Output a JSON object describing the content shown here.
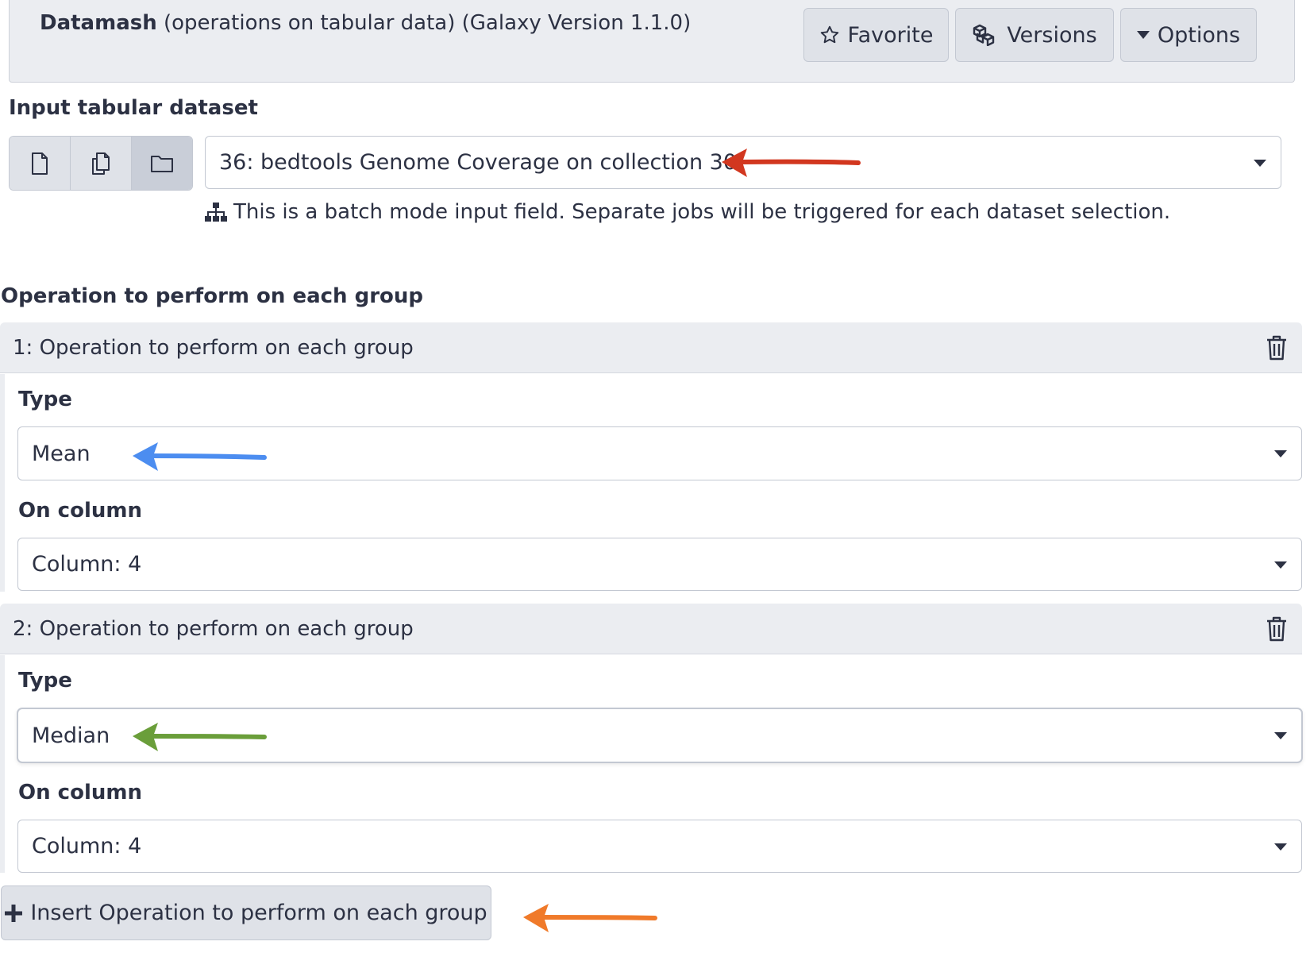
{
  "header": {
    "tool_name": "Datamash",
    "tool_description": "(operations on tabular data)",
    "tool_version": "(Galaxy Version 1.1.0)",
    "buttons": {
      "favorite": "Favorite",
      "versions": "Versions",
      "options": "Options"
    }
  },
  "input_dataset": {
    "label": "Input tabular dataset",
    "selected": "36: bedtools Genome Coverage on collection 30",
    "batch_note": "This is a batch mode input field. Separate jobs will be triggered for each dataset selection."
  },
  "operations": {
    "section_label": "Operation to perform on each group",
    "groups": [
      {
        "title": "1: Operation to perform on each group",
        "type_label": "Type",
        "type_value": "Mean",
        "column_label": "On column",
        "column_value": "Column: 4"
      },
      {
        "title": "2: Operation to perform on each group",
        "type_label": "Type",
        "type_value": "Median",
        "column_label": "On column",
        "column_value": "Column: 4"
      }
    ],
    "insert_button": "Insert Operation to perform on each group"
  },
  "annotation_colors": {
    "red": "#d2371f",
    "blue": "#4c8df0",
    "green": "#6a9e3a",
    "orange": "#f07a2a"
  },
  "icons": [
    "star-icon",
    "cubes-icon",
    "caret-down-icon",
    "file-icon",
    "files-icon",
    "folder-icon",
    "sitemap-icon",
    "trash-icon",
    "plus-icon"
  ]
}
